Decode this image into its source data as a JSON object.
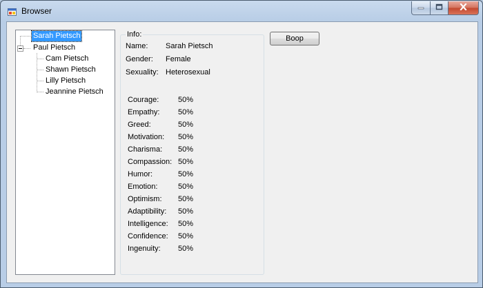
{
  "window": {
    "title": "Browser",
    "icon": "app-window-icon"
  },
  "caption_buttons": {
    "minimize": "minimize-icon",
    "maximize": "maximize-icon",
    "close": "close-icon"
  },
  "tree": {
    "nodes": [
      {
        "label": "Sarah Pietsch",
        "selected": true
      },
      {
        "label": "Paul Pietsch",
        "expanded": true,
        "children": [
          {
            "label": "Cam Pietsch"
          },
          {
            "label": "Shawn Pietsch"
          },
          {
            "label": "Lilly Pietsch"
          },
          {
            "label": "Jeannine Pietsch"
          }
        ]
      }
    ]
  },
  "info": {
    "legend": "Info:",
    "name_label": "Name:",
    "name_value": "Sarah Pietsch",
    "gender_label": "Gender:",
    "gender_value": "Female",
    "sexuality_label": "Sexuality:",
    "sexuality_value": "Heterosexual",
    "traits": [
      {
        "label": "Courage:",
        "value": "50%"
      },
      {
        "label": "Empathy:",
        "value": "50%"
      },
      {
        "label": "Greed:",
        "value": "50%"
      },
      {
        "label": "Motivation:",
        "value": "50%"
      },
      {
        "label": "Charisma:",
        "value": "50%"
      },
      {
        "label": "Compassion:",
        "value": "50%"
      },
      {
        "label": "Humor:",
        "value": "50%"
      },
      {
        "label": "Emotion:",
        "value": "50%"
      },
      {
        "label": "Optimism:",
        "value": "50%"
      },
      {
        "label": "Adaptibility:",
        "value": "50%"
      },
      {
        "label": "Intelligence:",
        "value": "50%"
      },
      {
        "label": "Confidence:",
        "value": "50%"
      },
      {
        "label": "Ingenuity:",
        "value": "50%"
      }
    ]
  },
  "boop_button": {
    "label": "Boop"
  },
  "colors": {
    "selection": "#3399ff",
    "client_bg": "#f0f0f0",
    "frame": "#b8cde6",
    "close_button": "#c3472e"
  }
}
